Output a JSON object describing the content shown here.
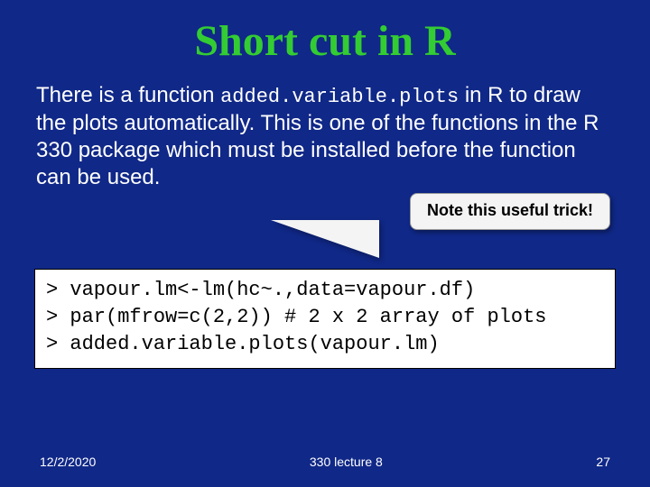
{
  "title": "Short cut in R",
  "para": {
    "lead": "There is a function ",
    "func": "added.variable.plots",
    "rest": " in R to draw the plots automatically. This is one of the functions in the R 330 package which must be installed before the function can be used."
  },
  "callout": "Note this useful trick!",
  "code": "> vapour.lm<-lm(hc~.,data=vapour.df)\n> par(mfrow=c(2,2)) # 2 x 2 array of plots\n> added.variable.plots(vapour.lm)",
  "footer": {
    "date": "12/2/2020",
    "center": "330 lecture 8",
    "page": "27"
  }
}
